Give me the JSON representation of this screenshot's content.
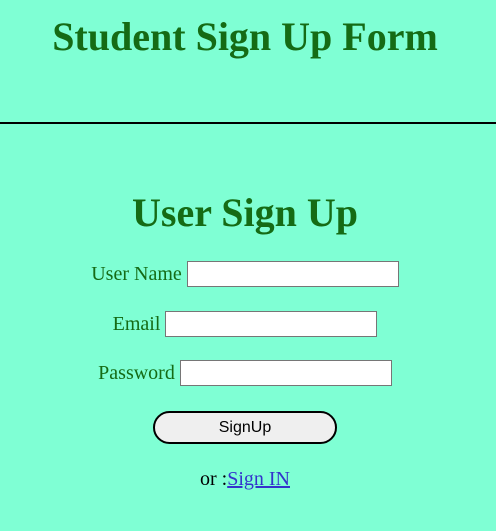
{
  "header": {
    "title": "Student Sign Up Form"
  },
  "form": {
    "title": "User Sign Up",
    "fields": {
      "username": {
        "label": "User Name",
        "value": ""
      },
      "email": {
        "label": "Email",
        "value": ""
      },
      "password": {
        "label": "Password",
        "value": ""
      }
    },
    "submit_label": "SignUp",
    "signin_prefix": "or :",
    "signin_link": "Sign IN"
  },
  "colors": {
    "background": "#7fffd4",
    "heading": "#156b15",
    "link": "#3333cc"
  }
}
